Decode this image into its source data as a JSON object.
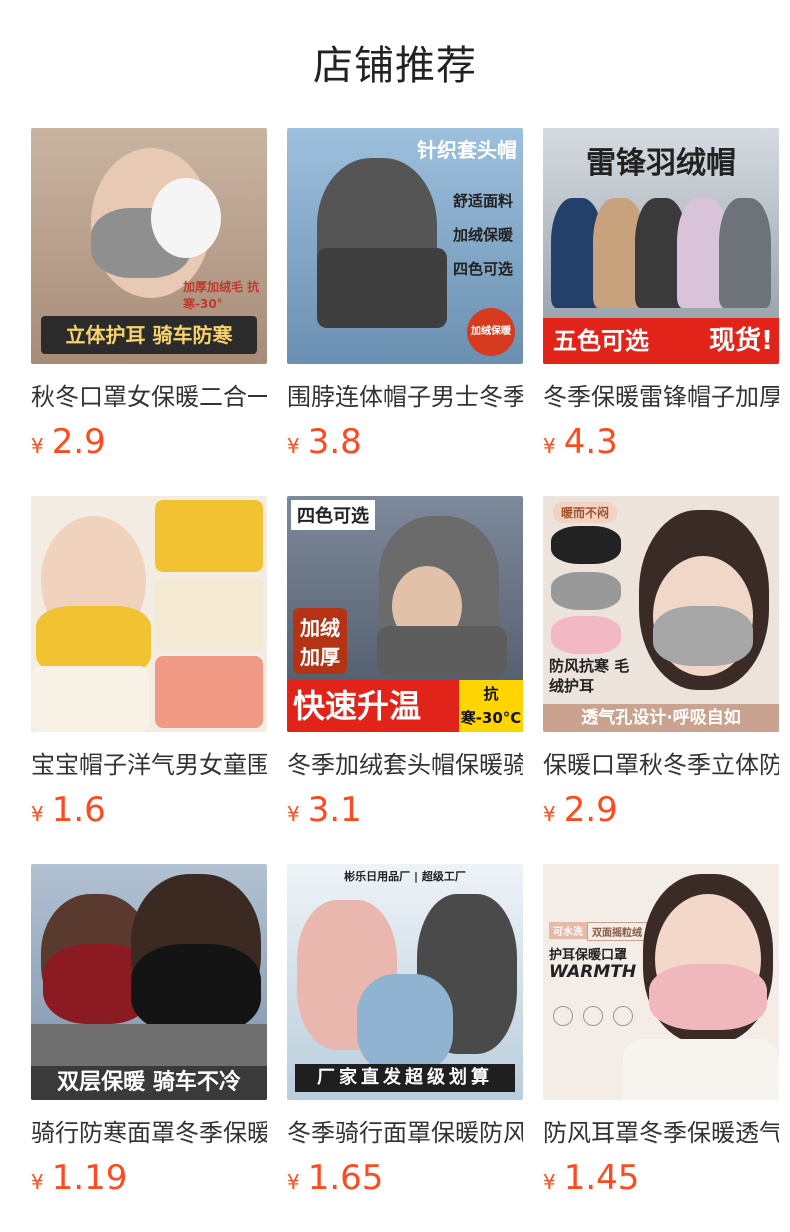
{
  "page": {
    "title": "店铺推荐"
  },
  "products": [
    {
      "name": "秋冬口罩女保暖二合一",
      "currency": "¥",
      "price": "2.9",
      "image": {
        "banner": "立体护耳 骑车防寒",
        "note": "加厚加绒毛 抗寒-30°",
        "bg": "#b79e8a",
        "banner_color": "#2b2b2b",
        "banner_text_color": "#f6d36b"
      }
    },
    {
      "name": "围脖连体帽子男士冬季",
      "currency": "¥",
      "price": "3.8",
      "image": {
        "top": "针织套头帽",
        "lines": [
          "舒适面料",
          "加绒保暖",
          "四色可选"
        ],
        "badge": "加绒保暖",
        "bg": "#7fa8c9"
      }
    },
    {
      "name": "冬季保暖雷锋帽子加厚",
      "currency": "¥",
      "price": "4.3",
      "image": {
        "top": "雷锋羽绒帽",
        "left": "五色可选",
        "right": "现货!",
        "bg": "#9aa4ad",
        "banner_color": "#e2231a"
      }
    },
    {
      "name": "宝宝帽子洋气男女童围脖",
      "currency": "¥",
      "price": "1.6",
      "image": {
        "bg": "#efe6da"
      }
    },
    {
      "name": "冬季加绒套头帽保暖骑车",
      "currency": "¥",
      "price": "3.1",
      "image": {
        "top": "四色可选",
        "side": "加绒加厚",
        "left": "快速升温",
        "right": "抗寒-30°C",
        "bg": "#5e6a7a",
        "banner_color": "#e2231a"
      }
    },
    {
      "name": "保暖口罩秋冬季立体防风",
      "currency": "¥",
      "price": "2.9",
      "image": {
        "top": "暖而不闷",
        "mid": "防风抗寒 毛绒护耳",
        "banner": "透气孔设计·呼吸自如",
        "bg": "#e9ded6",
        "banner_color": "#c9a38f"
      }
    },
    {
      "name": "骑行防寒面罩冬季保暖",
      "currency": "¥",
      "price": "1.19",
      "image": {
        "banner": "双层保暖 骑车不冷",
        "bg": "#8fa2b7",
        "banner_color": "#3a3a3a"
      }
    },
    {
      "name": "冬季骑行面罩保暖防风",
      "currency": "¥",
      "price": "1.65",
      "image": {
        "top": "彬乐日用品厂 | 超级工厂",
        "banner": "厂家直发超级划算",
        "bg": "#d9e5ef",
        "banner_color": "#1f1f1f"
      }
    },
    {
      "name": "防风耳罩冬季保暖透气",
      "currency": "¥",
      "price": "1.45",
      "image": {
        "tag1": "可水洗",
        "tag2": "双面摇粒绒",
        "title": "护耳保暖口罩",
        "word": "WARMTH",
        "bg": "#f1e9e4"
      }
    }
  ]
}
